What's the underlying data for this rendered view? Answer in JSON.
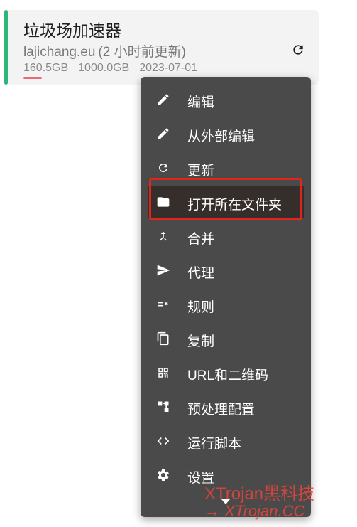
{
  "profile": {
    "title": "垃圾场加速器",
    "domain": "lajichang.eu",
    "updated": "(2 小时前更新)",
    "used": "160.5GB",
    "total": "1000.0GB",
    "expire": "2023-07-01",
    "usage_fraction": 0.16,
    "accent_color": "#2fb47c",
    "usage_color": "#ea6a7a"
  },
  "menu": {
    "items": [
      {
        "label": "编辑",
        "icon": "pencil-icon"
      },
      {
        "label": "从外部编辑",
        "icon": "pencil-icon"
      },
      {
        "label": "更新",
        "icon": "refresh-icon"
      },
      {
        "label": "打开所在文件夹",
        "icon": "folder-icon"
      },
      {
        "label": "合并",
        "icon": "merge-icon"
      },
      {
        "label": "代理",
        "icon": "send-icon"
      },
      {
        "label": "规则",
        "icon": "rule-icon"
      },
      {
        "label": "复制",
        "icon": "copy-icon"
      },
      {
        "label": "URL和二维码",
        "icon": "qrcode-icon"
      },
      {
        "label": "预处理配置",
        "icon": "schema-icon"
      },
      {
        "label": "运行脚本",
        "icon": "code-icon"
      },
      {
        "label": "设置",
        "icon": "gear-icon"
      }
    ],
    "active_index": 3,
    "highlight_color": "#e0261c"
  },
  "watermark": {
    "line1": "XTrojan黑科技",
    "line2": "→ XTrojan.CC"
  }
}
